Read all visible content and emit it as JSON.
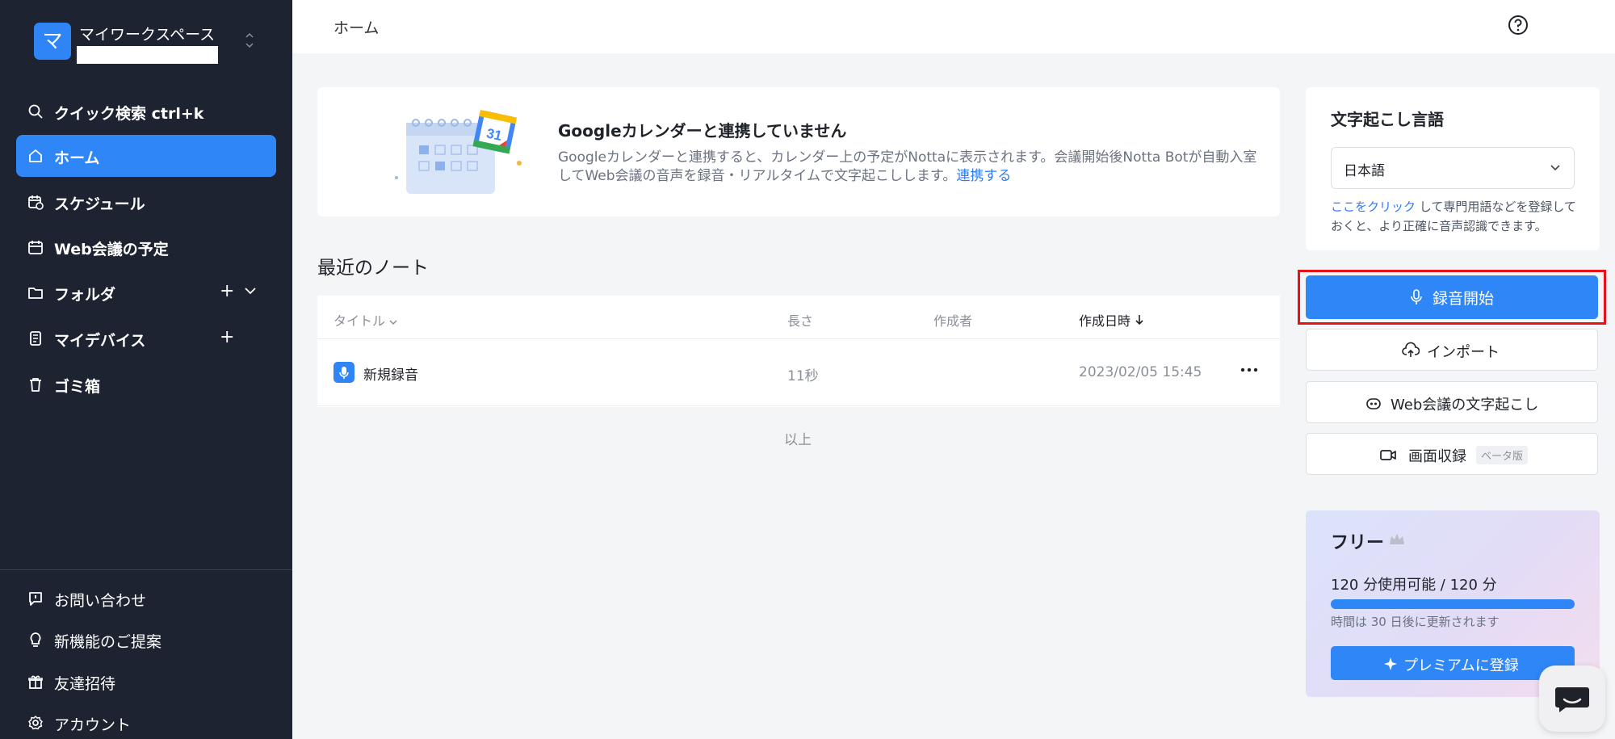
{
  "workspace": {
    "avatar_letter": "マ",
    "name": "マイワークスペース"
  },
  "sidebar": {
    "items": [
      {
        "label": "クイック検索 ctrl+k",
        "icon": "search-icon"
      },
      {
        "label": "ホーム",
        "icon": "home-icon",
        "active": true
      },
      {
        "label": "スケジュール",
        "icon": "calendar-clock-icon"
      },
      {
        "label": "Web会議の予定",
        "icon": "calendar-icon"
      },
      {
        "label": "フォルダ",
        "icon": "folder-icon"
      },
      {
        "label": "マイデバイス",
        "icon": "device-icon"
      },
      {
        "label": "ゴミ箱",
        "icon": "trash-icon"
      }
    ],
    "bottom_items": [
      {
        "label": "お問い合わせ",
        "icon": "message-icon"
      },
      {
        "label": "新機能のご提案",
        "icon": "lightbulb-icon"
      },
      {
        "label": "友達招待",
        "icon": "gift-icon"
      },
      {
        "label": "アカウント",
        "icon": "settings-icon"
      }
    ]
  },
  "header": {
    "breadcrumb": "ホーム"
  },
  "banner": {
    "title": "Googleカレンダーと連携していません",
    "description": "Googleカレンダーと連携すると、カレンダー上の予定がNottaに表示されます。会議開始後Notta Botが自動入室してWeb会議の音声を録音・リアルタイムで文字起こしします。",
    "link": "連携する",
    "calendar_day": "31"
  },
  "notes": {
    "section_title": "最近のノート",
    "columns": {
      "title": "タイトル",
      "length": "長さ",
      "author": "作成者",
      "created": "作成日時"
    },
    "rows": [
      {
        "title": "新規録音",
        "length": "11秒",
        "author": "",
        "created": "2023/02/05 15:45"
      }
    ],
    "end_label": "以上"
  },
  "language": {
    "title": "文字起こし言語",
    "selected": "日本語",
    "hint_link": "ここをクリック",
    "hint_text": " して専門用語などを登録しておくと、より正確に音声認識できます。"
  },
  "actions": {
    "record": "録音開始",
    "import": "インポート",
    "web_meeting": "Web会議の文字起こし",
    "screen_record": "画面収録",
    "beta": "ベータ版"
  },
  "plan": {
    "title": "フリー",
    "usage": "120 分使用可能 / 120 分",
    "usage_ratio": 1.0,
    "reset": "時間は 30 日後に更新されます",
    "premium_button": "プレミアムに登録"
  },
  "colors": {
    "accent": "#2f86f6",
    "sidebar_bg": "#1d2330",
    "highlight": "#e8111a"
  }
}
